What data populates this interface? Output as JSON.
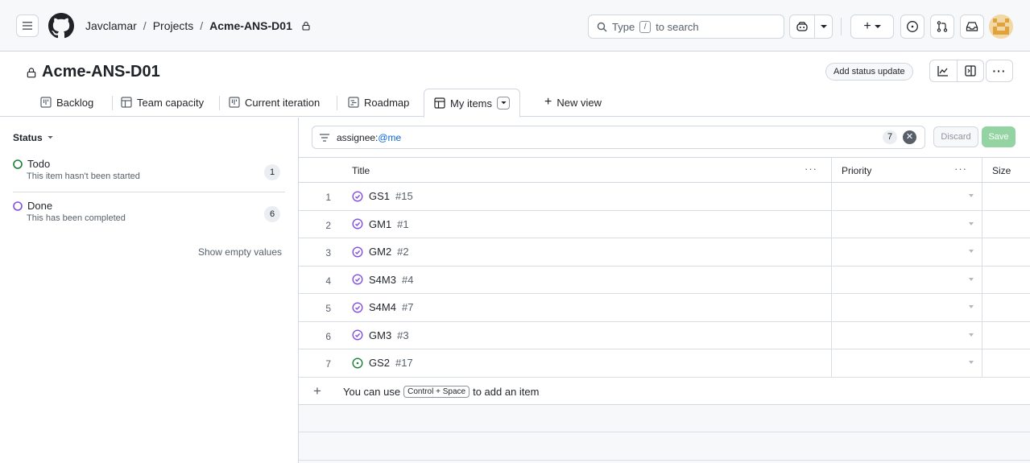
{
  "header": {
    "breadcrumb": [
      "Javclamar",
      "Projects",
      "Acme-ANS-D01"
    ],
    "search_prefix": "Type",
    "search_key": "/",
    "search_suffix": "to search"
  },
  "project": {
    "title": "Acme-ANS-D01",
    "status_update": "Add status update"
  },
  "tabs": [
    "Backlog",
    "Team capacity",
    "Current iteration",
    "Roadmap",
    "My items",
    "New view"
  ],
  "sidebar": {
    "heading": "Status",
    "items": [
      {
        "label": "Todo",
        "description": "This item hasn't been started",
        "count": "1",
        "color": "#1a7f37"
      },
      {
        "label": "Done",
        "description": "This has been completed",
        "count": "6",
        "color": "#8250df"
      }
    ],
    "show_empty": "Show empty values"
  },
  "filter": {
    "key": "assignee:",
    "value": "@me",
    "count": "7",
    "discard": "Discard",
    "save": "Save"
  },
  "table": {
    "columns": [
      "Title",
      "Priority",
      "Size"
    ],
    "rows": [
      {
        "n": "1",
        "title": "GS1",
        "num": "#15",
        "state": "done"
      },
      {
        "n": "2",
        "title": "GM1",
        "num": "#1",
        "state": "done"
      },
      {
        "n": "3",
        "title": "GM2",
        "num": "#2",
        "state": "done"
      },
      {
        "n": "4",
        "title": "S4M3",
        "num": "#4",
        "state": "done"
      },
      {
        "n": "5",
        "title": "S4M4",
        "num": "#7",
        "state": "done"
      },
      {
        "n": "6",
        "title": "GM3",
        "num": "#3",
        "state": "done"
      },
      {
        "n": "7",
        "title": "GS2",
        "num": "#17",
        "state": "open"
      }
    ],
    "add_prefix": "You can use",
    "add_kbd": "Control + Space",
    "add_suffix": "to add an item"
  }
}
